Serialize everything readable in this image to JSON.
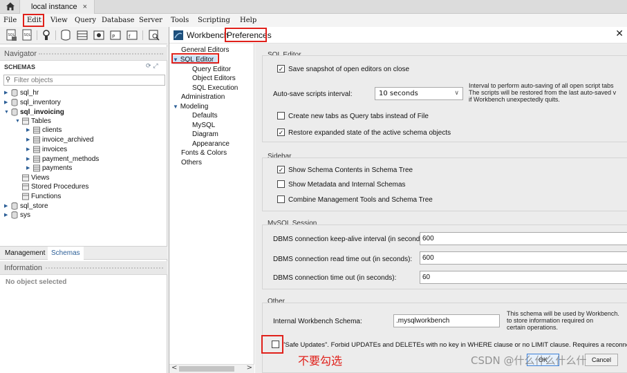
{
  "tabs": {
    "instance": "local instance",
    "close": "×"
  },
  "menu": [
    {
      "key": "file",
      "label": "File"
    },
    {
      "key": "edit",
      "label": "Edit"
    },
    {
      "key": "view",
      "label": "View"
    },
    {
      "key": "query",
      "label": "Query"
    },
    {
      "key": "database",
      "label": "Database"
    },
    {
      "key": "server",
      "label": "Server"
    },
    {
      "key": "tools",
      "label": "Tools"
    },
    {
      "key": "scripting",
      "label": "Scripting"
    },
    {
      "key": "help",
      "label": "Help"
    }
  ],
  "navigator": {
    "header": "Navigator",
    "schemas_label": "SCHEMAS",
    "filter_placeholder": "Filter objects",
    "tree": [
      {
        "label": "sql_hr"
      },
      {
        "label": "sql_inventory"
      },
      {
        "label": "sql_invoicing"
      },
      {
        "label": "Tables"
      },
      {
        "label": "clients"
      },
      {
        "label": "invoice_archived"
      },
      {
        "label": "invoices"
      },
      {
        "label": "payment_methods"
      },
      {
        "label": "payments"
      },
      {
        "label": "Views"
      },
      {
        "label": "Stored Procedures"
      },
      {
        "label": "Functions"
      },
      {
        "label": "sql_store"
      },
      {
        "label": "sys"
      }
    ],
    "bottom_tabs": {
      "management": "Management",
      "schemas": "Schemas"
    },
    "information_header": "Information",
    "no_object": "No object selected"
  },
  "preferences": {
    "title_a": "Workbench",
    "title_b": "Preferences",
    "close": "✕",
    "nav": [
      {
        "label": "General Editors"
      },
      {
        "label": "SQL Editor"
      },
      {
        "label": "Query Editor"
      },
      {
        "label": "Object Editors"
      },
      {
        "label": "SQL Execution"
      },
      {
        "label": "Administration"
      },
      {
        "label": "Modeling"
      },
      {
        "label": "Defaults"
      },
      {
        "label": "MySQL"
      },
      {
        "label": "Diagram"
      },
      {
        "label": "Appearance"
      },
      {
        "label": "Fonts & Colors"
      },
      {
        "label": "Others"
      }
    ],
    "sql_editor": {
      "title": "SQL Editor",
      "save_snapshot": "Save snapshot of open editors on close",
      "autosave_label": "Auto-save scripts interval:",
      "autosave_value": "10 seconds",
      "autosave_note_1": "Interval to perform auto-saving of all open script tabs",
      "autosave_note_2": "The scripts will be restored from the last auto-saved v",
      "autosave_note_3": "if Workbench unexpectedly quits.",
      "new_tabs": "Create new tabs as Query tabs instead of File",
      "restore_state": "Restore expanded state of the active schema objects"
    },
    "sidebar": {
      "title": "Sidebar",
      "show_schema": "Show Schema Contents in Schema Tree",
      "show_metadata": "Show Metadata and Internal Schemas",
      "combine_tools": "Combine Management Tools and Schema Tree"
    },
    "mysql_session": {
      "title": "MySQL Session",
      "keepalive_label": "DBMS connection keep-alive interval (in seconds):",
      "keepalive_value": "600",
      "read_timeout_label": "DBMS connection read time out (in seconds):",
      "read_timeout_value": "600",
      "timeout_label": "DBMS connection time out (in seconds):",
      "timeout_value": "60"
    },
    "other": {
      "title": "Other",
      "schema_label": "Internal Workbench Schema:",
      "schema_value": ".mysqlworkbench",
      "schema_note_1": "This schema will be used by Workbench.",
      "schema_note_2": "to store information required on",
      "schema_note_3": "certain operations.",
      "safe_updates": "\"Safe Updates\". Forbid UPDATEs and DELETEs with no key in WHERE clause or no LIMIT clause. Requires a reconnection"
    },
    "ok": "OK",
    "cancel": "Cancel"
  },
  "annotation": {
    "note": "不要勾选"
  },
  "watermark": "CSDN @什么什么什么什",
  "colors": {
    "annotation_red": "#e0201a",
    "selection_blue": "#cfe3f7",
    "accent_blue": "#2c5f97"
  }
}
